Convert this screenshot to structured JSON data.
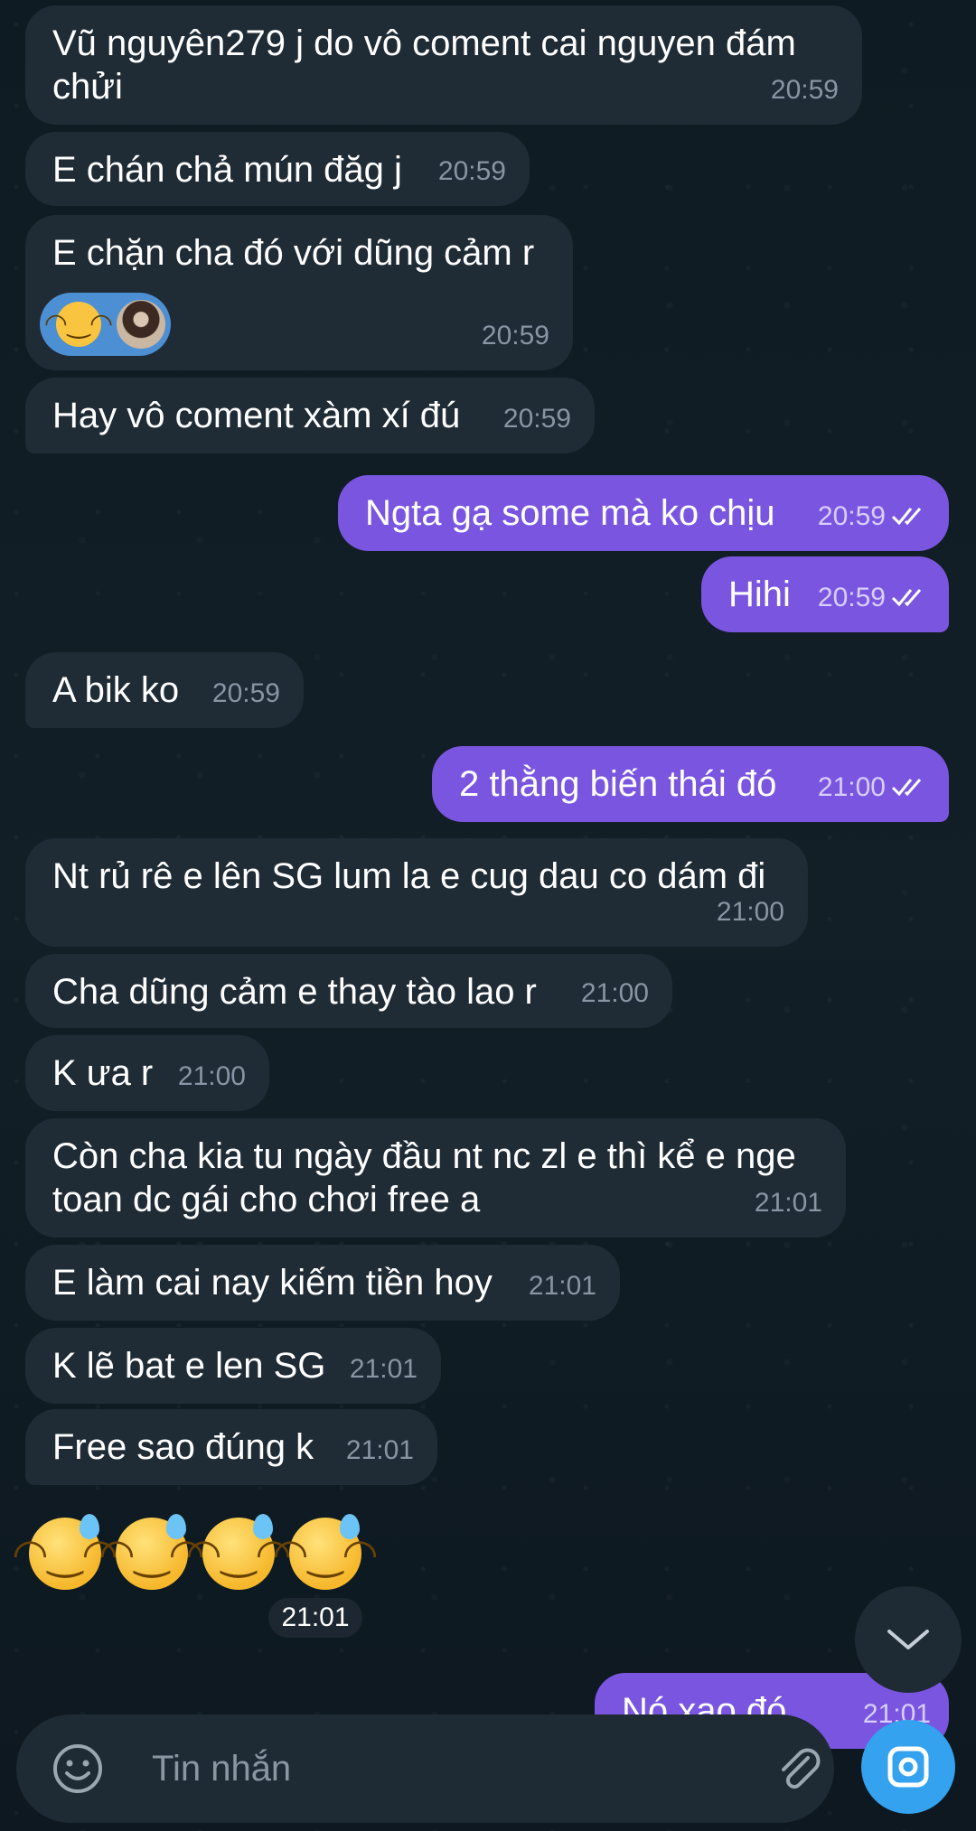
{
  "messages": [
    {
      "text": "Vũ nguyên279 j do vô coment cai nguyen đám\nchửi",
      "time": "20:59"
    },
    {
      "text": "E chán chả mún đăg j",
      "time": "20:59"
    },
    {
      "text": "E chặn cha đó với dũng cảm r",
      "time": "20:59",
      "reaction": "grinning-face"
    },
    {
      "text": "Hay vô coment xàm xí đú",
      "time": "20:59"
    },
    {
      "text": "Ngta gạ some mà ko chịu",
      "time": "20:59"
    },
    {
      "text": "Hihi",
      "time": "20:59"
    },
    {
      "text": "A bik ko",
      "time": "20:59"
    },
    {
      "text": "2 thằng biến thái đó",
      "time": "21:00"
    },
    {
      "text": "Nt rủ rê e lên SG lum la e cug dau co dám đi",
      "time": "21:00"
    },
    {
      "text": "Cha dũng cảm e thay tào lao r",
      "time": "21:00"
    },
    {
      "text": "K ưa r",
      "time": "21:00"
    },
    {
      "text": "Còn cha kia tu ngày đầu nt nc zl e thì kể e nge\ntoan dc gái cho chơi free a",
      "time": "21:01"
    },
    {
      "text": "E làm cai nay kiếm tiền hoy",
      "time": "21:01"
    },
    {
      "text": "K lẽ bat e len SG",
      "time": "21:01"
    },
    {
      "text": "Free sao đúng k",
      "time": "21:01"
    },
    {
      "text": "Nó xạo đó",
      "time": "21:01"
    }
  ],
  "emoji_message": {
    "icons": [
      "grinning-face-with-sweat",
      "grinning-face-with-sweat",
      "grinning-face-with-sweat",
      "grinning-face-with-sweat"
    ],
    "time": "21:01"
  },
  "input": {
    "placeholder": "Tin nhắn"
  },
  "colors": {
    "incoming": "#1f2b35",
    "outgoing": "#7a56e0",
    "accent": "#34a2ef"
  }
}
